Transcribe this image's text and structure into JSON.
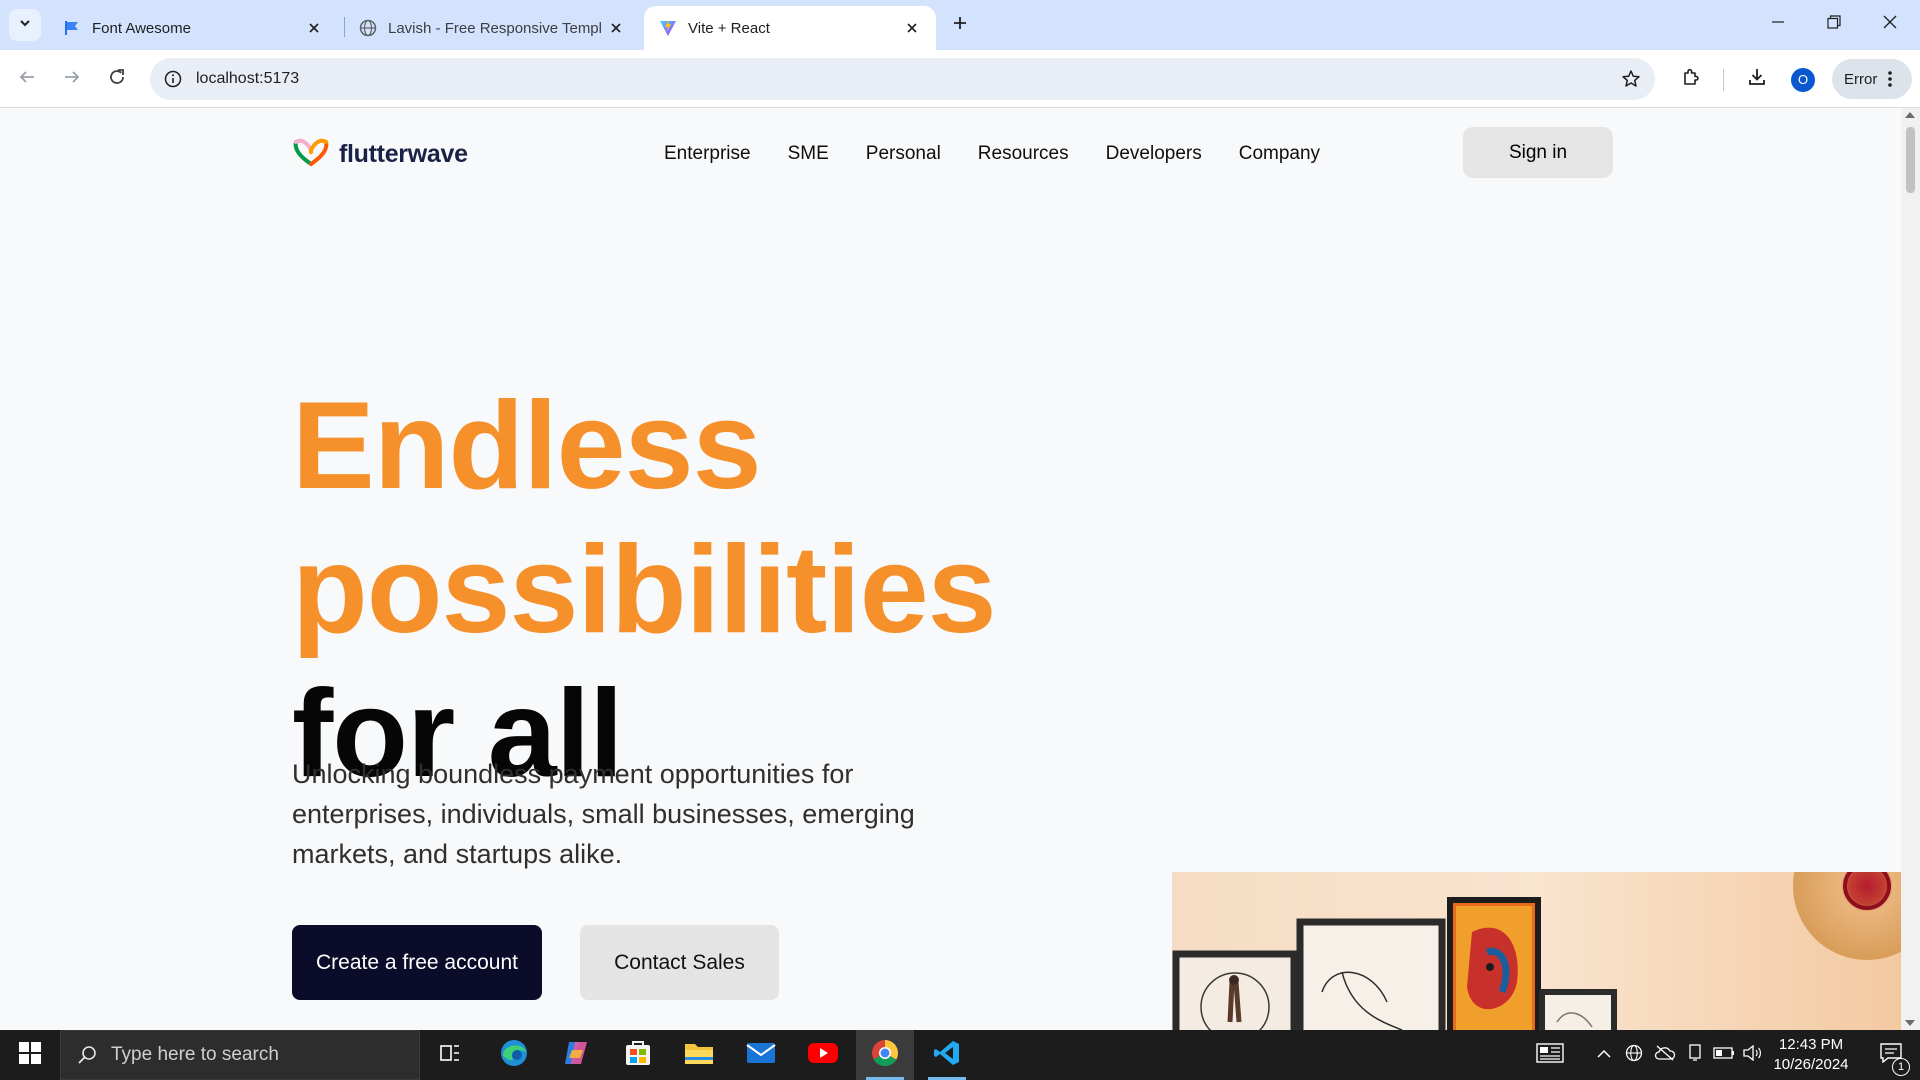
{
  "browser": {
    "tabs": [
      {
        "title": "Font Awesome",
        "favicon": "flag-icon"
      },
      {
        "title": "Lavish - Free Responsive Templ",
        "favicon": "globe-icon"
      },
      {
        "title": "Vite + React",
        "favicon": "vite-icon",
        "active": true
      }
    ],
    "url": "localhost:5173",
    "profile_initial": "O",
    "error_label": "Error"
  },
  "site": {
    "logo_text": "flutterwave",
    "nav": [
      "Enterprise",
      "SME",
      "Personal",
      "Resources",
      "Developers",
      "Company"
    ],
    "signin_label": "Sign in",
    "hero": {
      "line1": "Endless",
      "line2": "possibilities",
      "line3": "for all",
      "subtitle": "Unlocking boundless payment opportunities for enterprises, individuals, small businesses, emerging markets, and startups alike.",
      "primary_cta": "Create a free account",
      "secondary_cta": "Contact Sales"
    },
    "colors": {
      "accent": "#f5902b",
      "dark": "#0a0c29"
    }
  },
  "taskbar": {
    "search_placeholder": "Type here to search",
    "apps": [
      "task-view-icon",
      "edge-icon",
      "copilot-icon",
      "store-icon",
      "file-explorer-icon",
      "mail-icon",
      "youtube-icon",
      "chrome-icon",
      "vscode-icon"
    ],
    "time": "12:43 PM",
    "date": "10/26/2024",
    "notification_count": "1"
  }
}
